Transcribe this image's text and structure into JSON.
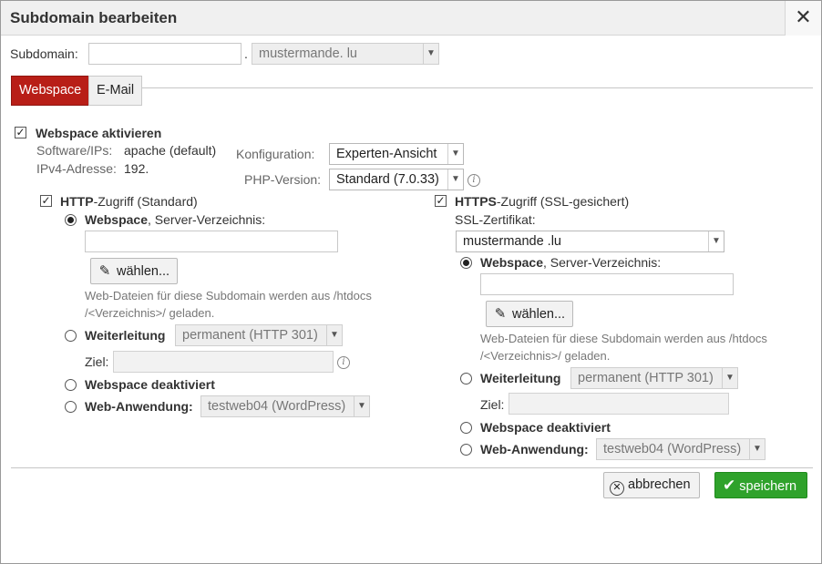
{
  "dialog": {
    "title": "Subdomain bearbeiten",
    "close_glyph": "✕"
  },
  "subdomain": {
    "label": "Subdomain:",
    "value": "",
    "dot": ".",
    "domain_select": "mustermande.     lu"
  },
  "tabs": [
    {
      "label": "Webspace",
      "active": true
    },
    {
      "label": "E-Mail",
      "active": false
    }
  ],
  "webspace": {
    "activate_label": "Webspace aktivieren",
    "activate_checked": true,
    "software_label": "Software/IPs:",
    "software_value": "apache (default)",
    "ipv4_label": "IPv4-Adresse:",
    "ipv4_value": "192.",
    "config_label": "Konfiguration:",
    "config_value": "Experten-Ansicht",
    "php_label": "PHP-Version:",
    "php_value": "Standard (7.0.33)"
  },
  "http": {
    "title_bold": "HTTP",
    "title_rest": "-Zugriff (Standard)",
    "checked": true,
    "webspace_bold": "Webspace",
    "webspace_rest": ", Server-Verzeichnis:",
    "dir_value": "",
    "choose_label": "wählen...",
    "hint_line1": "Web-Dateien für diese Subdomain werden aus /htdocs",
    "hint_line2": "/<Verzeichnis>/ geladen.",
    "redirect_label": "Weiterleitung",
    "redirect_select": "permanent (HTTP 301)",
    "target_label": "Ziel:",
    "target_value": "",
    "disabled_label": "Webspace deaktiviert",
    "webapp_label": "Web-Anwendung:",
    "webapp_select": "testweb04 (WordPress)"
  },
  "https": {
    "title_bold": "HTTPS",
    "title_rest": "-Zugriff (SSL-gesichert)",
    "checked": true,
    "ssl_label": "SSL-Zertifikat:",
    "ssl_value": "mustermande         .lu",
    "webspace_bold": "Webspace",
    "webspace_rest": ", Server-Verzeichnis:",
    "dir_value": "",
    "choose_label": "wählen...",
    "hint_line1": "Web-Dateien für diese Subdomain werden aus /htdocs",
    "hint_line2": "/<Verzeichnis>/ geladen.",
    "redirect_label": "Weiterleitung",
    "redirect_select": "permanent (HTTP 301)",
    "target_label": "Ziel:",
    "target_value": "",
    "disabled_label": "Webspace deaktiviert",
    "webapp_label": "Web-Anwendung:",
    "webapp_select": "testweb04 (WordPress)"
  },
  "footer": {
    "cancel_label": "abbrechen",
    "save_label": "speichern"
  },
  "colors": {
    "tab_active": "#b81e17",
    "save_button": "#2fa22b"
  },
  "icons": {
    "close": "close-icon",
    "checkbox": "checkbox-checked-icon",
    "radio": "radio-icon",
    "pencil": "pencil-icon",
    "info": "info-icon",
    "cancel": "cancel-circle-icon",
    "check": "checkmark-icon",
    "caret": "chevron-down-icon"
  }
}
